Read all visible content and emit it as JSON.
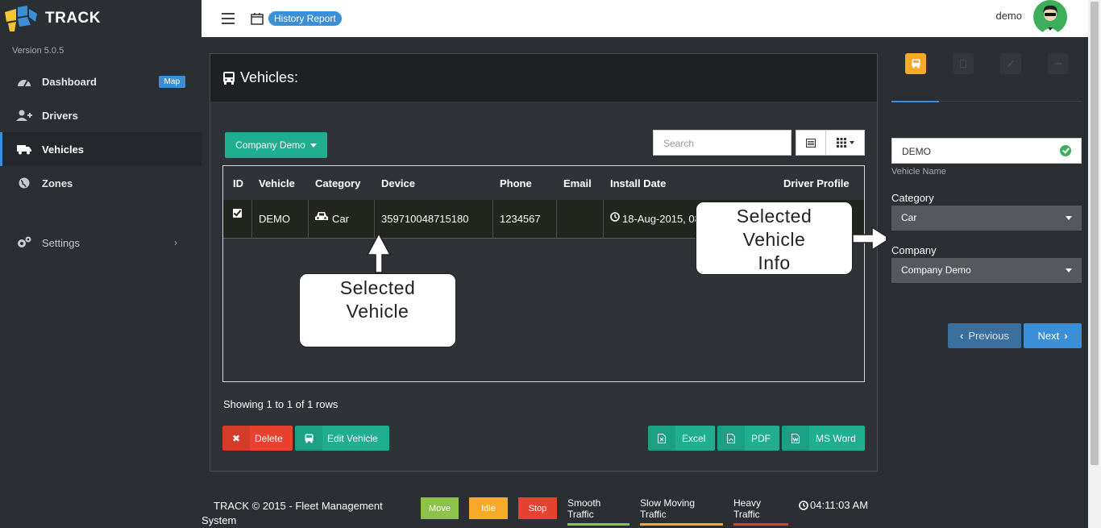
{
  "brand": {
    "name": "TRACK",
    "version": "Version 5.0.5"
  },
  "sidebar": {
    "items": [
      {
        "label": "Dashboard",
        "badge": "Map",
        "icon": "dashboard-icon"
      },
      {
        "label": "Drivers",
        "icon": "add-user-icon"
      },
      {
        "label": "Vehicles",
        "icon": "truck-icon"
      },
      {
        "label": "Zones",
        "icon": "globe-icon"
      },
      {
        "label": "Settings",
        "icon": "gears-icon"
      }
    ]
  },
  "topbar": {
    "report_badge": "History Report",
    "user": "demo"
  },
  "main": {
    "title": "Vehicles:",
    "company_button": "Company Demo",
    "search_placeholder": "Search",
    "columns": [
      "ID",
      "Vehicle",
      "Category",
      "Device",
      "Phone",
      "Email",
      "Install Date",
      "Driver Profile"
    ],
    "row": {
      "vehicle": "DEMO",
      "category": "Car",
      "device": "359710048715180",
      "phone": "1234567",
      "email": "",
      "install_date": "18-Aug-2015, 08"
    },
    "showing": "Showing 1 to 1 of 1 rows",
    "buttons": {
      "delete": "Delete",
      "edit": "Edit Vehicle",
      "excel": "Excel",
      "pdf": "PDF",
      "word": "MS Word"
    }
  },
  "callouts": {
    "vehicle_1": "Selected",
    "vehicle_2": "Vehicle",
    "info_1": "Selected",
    "info_2": "Vehicle",
    "info_3": "Info"
  },
  "right_panel": {
    "vehicle_name_value": "DEMO",
    "vehicle_name_label": "Vehicle Name",
    "category_label": "Category",
    "category_value": "Car",
    "company_label": "Company",
    "company_value": "Company Demo",
    "previous": "Previous",
    "next": "Next"
  },
  "footer": {
    "copyright": "TRACK © 2015 - Fleet Management System",
    "chips": [
      "Move",
      "Idle",
      "Stop"
    ],
    "traffic": [
      "Smooth Traffic",
      "Slow Moving Traffic",
      "Heavy Traffic"
    ],
    "time": "04:11:03 AM"
  },
  "colors": {
    "accent_blue": "#3b8fd6",
    "teal": "#1fae8f",
    "red": "#e7412f",
    "orange": "#f7a928",
    "green": "#8bc34a"
  }
}
